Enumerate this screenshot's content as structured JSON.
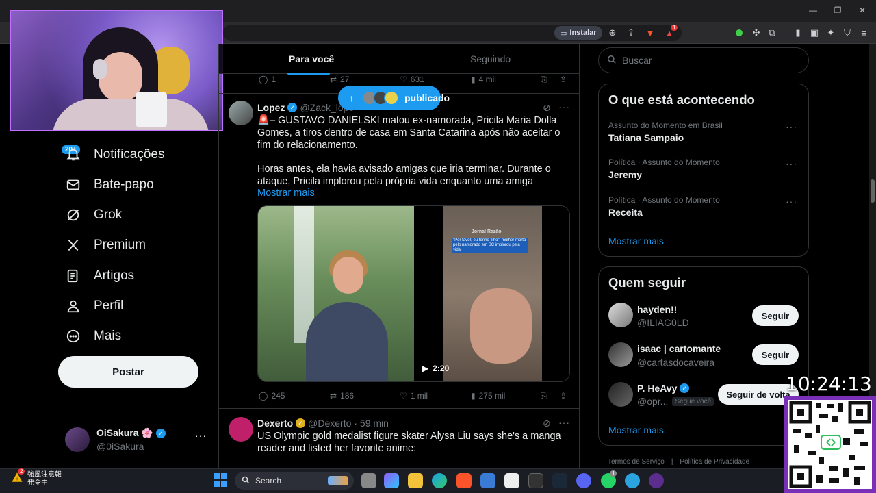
{
  "browser": {
    "install_label": "Instalar",
    "ext_badge": "1"
  },
  "nav": {
    "notif_badge": "20+",
    "items": [
      {
        "label": "Notificações",
        "icon": "bell-icon"
      },
      {
        "label": "Bate-papo",
        "icon": "mail-icon"
      },
      {
        "label": "Grok",
        "icon": "grok-icon"
      },
      {
        "label": "Premium",
        "icon": "x-logo-icon"
      },
      {
        "label": "Artigos",
        "icon": "article-icon"
      },
      {
        "label": "Perfil",
        "icon": "person-icon"
      },
      {
        "label": "Mais",
        "icon": "more-circle-icon"
      }
    ],
    "post_label": "Postar",
    "account": {
      "name": "OiSakura",
      "emoji": "🌸",
      "handle": "@0iSakura"
    }
  },
  "feed": {
    "tabs": [
      "Para você",
      "Seguindo"
    ],
    "top_actions": {
      "replies": "1",
      "reposts": "27",
      "likes": "631",
      "views": "4 mil"
    },
    "new_posts_pill": "publicado",
    "tweet1": {
      "name": "Lopez",
      "handle": "@Zack_lope",
      "text1": "🚨– GUSTAVO DANIELSKI matou ex-namorada, Pricila Maria Dolla Gomes, a tiros dentro de casa em Santa Catarina após não aceitar o fim do relacionamento.",
      "text2": "Horas antes, ela havia avisado amigas que iria terminar. Durante o ataque, Pricila implorou pela própria vida enquanto uma amiga",
      "show_more": "Mostrar mais",
      "media_logo": "Jornal Razão",
      "media_caption": "\"Por favor, eu tenho filho\": mulher morta pelo namorado em SC implorou pela vida",
      "duration": "2:20",
      "replies": "245",
      "reposts": "186",
      "likes": "1 mil",
      "views": "275 mil"
    },
    "tweet2": {
      "name": "Dexerto",
      "handle": "@Dexerto",
      "time": "· 59 min",
      "text": "US Olympic gold medalist figure skater Alysa Liu says she's a manga reader and listed her favorite anime:"
    }
  },
  "sidebar": {
    "search_placeholder": "Buscar",
    "trends_title": "O que está acontecendo",
    "trends": [
      {
        "meta": "Assunto do Momento em Brasil",
        "name": "Tatiana Sampaio"
      },
      {
        "meta": "Política · Assunto do Momento",
        "name": "Jeremy"
      },
      {
        "meta": "Política · Assunto do Momento",
        "name": "Receita"
      }
    ],
    "show_more": "Mostrar mais",
    "follow_title": "Quem seguir",
    "follows": [
      {
        "name": "hayden!!",
        "handle": "@ILIAG0LD",
        "button": "Seguir"
      },
      {
        "name": "isaac | cartomante",
        "handle": "@cartasdocaveira",
        "button": "Seguir"
      },
      {
        "name": "P. HeAvy",
        "handle": "@opr...",
        "tag": "Segue você",
        "button": "Seguir de volta"
      }
    ],
    "follow_more": "Mostrar mais",
    "footer": [
      "Termos de Serviço",
      "Política de Privacidade"
    ]
  },
  "overlay": {
    "clock": "10:24:13"
  },
  "taskbar": {
    "weather_line1": "強風注意報",
    "weather_line2": "発令中",
    "weather_badge": "2",
    "search_label": "Search",
    "wa_badge": "1"
  },
  "colors": {
    "accent": "#1d9bf0",
    "bg": "#000000",
    "text": "#e7e9ea",
    "muted": "#71767b",
    "overlay_border": "#7a2fb8"
  }
}
